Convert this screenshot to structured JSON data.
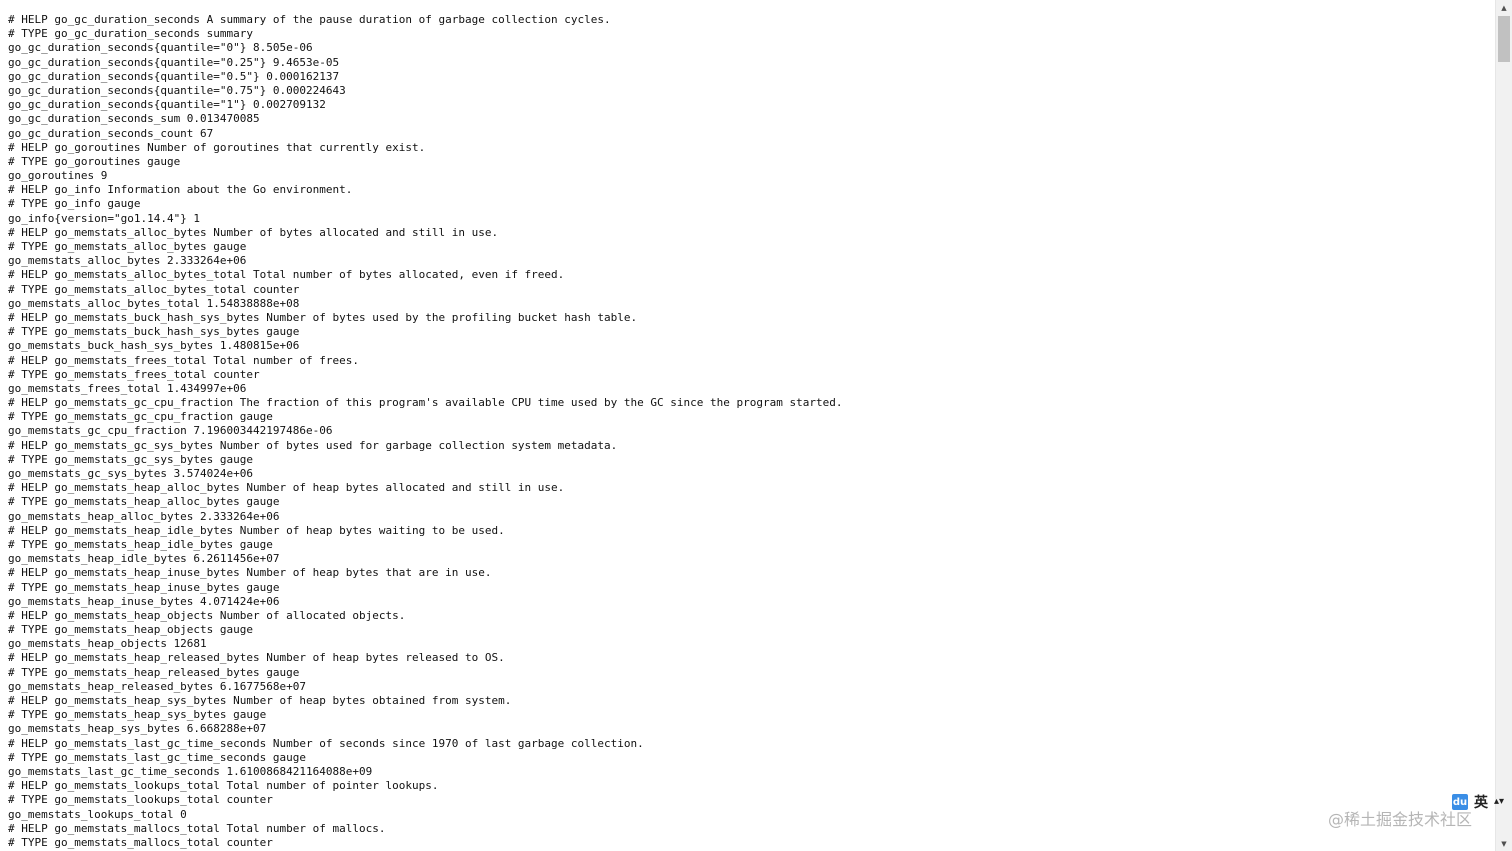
{
  "lines": [
    "# HELP go_gc_duration_seconds A summary of the pause duration of garbage collection cycles.",
    "# TYPE go_gc_duration_seconds summary",
    "go_gc_duration_seconds{quantile=\"0\"} 8.505e-06",
    "go_gc_duration_seconds{quantile=\"0.25\"} 9.4653e-05",
    "go_gc_duration_seconds{quantile=\"0.5\"} 0.000162137",
    "go_gc_duration_seconds{quantile=\"0.75\"} 0.000224643",
    "go_gc_duration_seconds{quantile=\"1\"} 0.002709132",
    "go_gc_duration_seconds_sum 0.013470085",
    "go_gc_duration_seconds_count 67",
    "# HELP go_goroutines Number of goroutines that currently exist.",
    "# TYPE go_goroutines gauge",
    "go_goroutines 9",
    "# HELP go_info Information about the Go environment.",
    "# TYPE go_info gauge",
    "go_info{version=\"go1.14.4\"} 1",
    "# HELP go_memstats_alloc_bytes Number of bytes allocated and still in use.",
    "# TYPE go_memstats_alloc_bytes gauge",
    "go_memstats_alloc_bytes 2.333264e+06",
    "# HELP go_memstats_alloc_bytes_total Total number of bytes allocated, even if freed.",
    "# TYPE go_memstats_alloc_bytes_total counter",
    "go_memstats_alloc_bytes_total 1.54838888e+08",
    "# HELP go_memstats_buck_hash_sys_bytes Number of bytes used by the profiling bucket hash table.",
    "# TYPE go_memstats_buck_hash_sys_bytes gauge",
    "go_memstats_buck_hash_sys_bytes 1.480815e+06",
    "# HELP go_memstats_frees_total Total number of frees.",
    "# TYPE go_memstats_frees_total counter",
    "go_memstats_frees_total 1.434997e+06",
    "# HELP go_memstats_gc_cpu_fraction The fraction of this program's available CPU time used by the GC since the program started.",
    "# TYPE go_memstats_gc_cpu_fraction gauge",
    "go_memstats_gc_cpu_fraction 7.196003442197486e-06",
    "# HELP go_memstats_gc_sys_bytes Number of bytes used for garbage collection system metadata.",
    "# TYPE go_memstats_gc_sys_bytes gauge",
    "go_memstats_gc_sys_bytes 3.574024e+06",
    "# HELP go_memstats_heap_alloc_bytes Number of heap bytes allocated and still in use.",
    "# TYPE go_memstats_heap_alloc_bytes gauge",
    "go_memstats_heap_alloc_bytes 2.333264e+06",
    "# HELP go_memstats_heap_idle_bytes Number of heap bytes waiting to be used.",
    "# TYPE go_memstats_heap_idle_bytes gauge",
    "go_memstats_heap_idle_bytes 6.2611456e+07",
    "# HELP go_memstats_heap_inuse_bytes Number of heap bytes that are in use.",
    "# TYPE go_memstats_heap_inuse_bytes gauge",
    "go_memstats_heap_inuse_bytes 4.071424e+06",
    "# HELP go_memstats_heap_objects Number of allocated objects.",
    "# TYPE go_memstats_heap_objects gauge",
    "go_memstats_heap_objects 12681",
    "# HELP go_memstats_heap_released_bytes Number of heap bytes released to OS.",
    "# TYPE go_memstats_heap_released_bytes gauge",
    "go_memstats_heap_released_bytes 6.1677568e+07",
    "# HELP go_memstats_heap_sys_bytes Number of heap bytes obtained from system.",
    "# TYPE go_memstats_heap_sys_bytes gauge",
    "go_memstats_heap_sys_bytes 6.668288e+07",
    "# HELP go_memstats_last_gc_time_seconds Number of seconds since 1970 of last garbage collection.",
    "# TYPE go_memstats_last_gc_time_seconds gauge",
    "go_memstats_last_gc_time_seconds 1.6100868421164088e+09",
    "# HELP go_memstats_lookups_total Total number of pointer lookups.",
    "# TYPE go_memstats_lookups_total counter",
    "go_memstats_lookups_total 0",
    "# HELP go_memstats_mallocs_total Total number of mallocs.",
    "# TYPE go_memstats_mallocs_total counter"
  ],
  "ime_toolbar": {
    "du_label": "du",
    "lang_label": "英",
    "toggle_label": "▴▾"
  },
  "watermark": "@稀土掘金技术社区",
  "scrollbar": {
    "up_arrow": "▲",
    "down_arrow": "▼"
  }
}
